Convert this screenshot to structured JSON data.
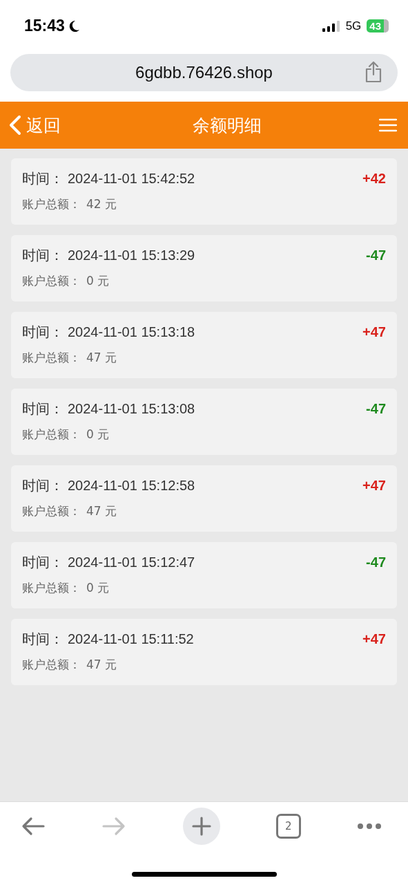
{
  "status_bar": {
    "time": "15:43",
    "network": "5G",
    "battery": "43"
  },
  "browser": {
    "url": "6gdbb.76426.shop",
    "tab_count": "2",
    "forward_disabled": true
  },
  "header": {
    "back": "返回",
    "title": "余额明细"
  },
  "entries": [
    {
      "time_label": "时间：",
      "time": "2024-11-01 15:42:52",
      "balance_label": "账户总额：",
      "balance": "42 元",
      "amount": "+42",
      "kind": "credit"
    },
    {
      "time_label": "时间：",
      "time": "2024-11-01 15:13:29",
      "balance_label": "账户总额：",
      "balance": "0 元",
      "amount": "-47",
      "kind": "debit"
    },
    {
      "time_label": "时间：",
      "time": "2024-11-01 15:13:18",
      "balance_label": "账户总额：",
      "balance": "47 元",
      "amount": "+47",
      "kind": "credit"
    },
    {
      "time_label": "时间：",
      "time": "2024-11-01 15:13:08",
      "balance_label": "账户总额：",
      "balance": "0 元",
      "amount": "-47",
      "kind": "debit"
    },
    {
      "time_label": "时间：",
      "time": "2024-11-01 15:12:58",
      "balance_label": "账户总额：",
      "balance": "47 元",
      "amount": "+47",
      "kind": "credit"
    },
    {
      "time_label": "时间：",
      "time": "2024-11-01 15:12:47",
      "balance_label": "账户总额：",
      "balance": "0 元",
      "amount": "-47",
      "kind": "debit"
    },
    {
      "time_label": "时间：",
      "time": "2024-11-01 15:11:52",
      "balance_label": "账户总额：",
      "balance": "47 元",
      "amount": "+47",
      "kind": "credit"
    }
  ]
}
